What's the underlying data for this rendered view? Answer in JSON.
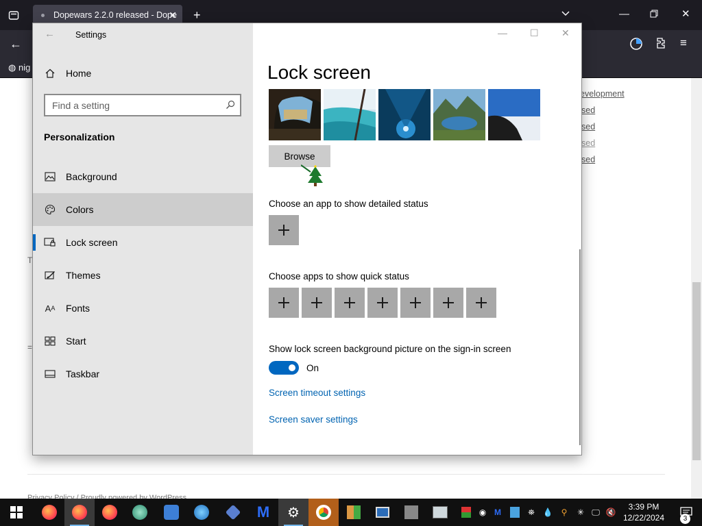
{
  "browser": {
    "tab_title": "Dopewars 2.2.0 released - Dope",
    "bookmark_label": "nig"
  },
  "background_page": {
    "links": [
      "evelopment",
      "sed",
      "sed",
      "sed",
      "sed"
    ],
    "fragments": [
      "T",
      "=",
      "Privacy Policy / Proudly powered by WordPress"
    ]
  },
  "settings": {
    "window_title": "Settings",
    "sidebar": {
      "home_label": "Home",
      "search_placeholder": "Find a setting",
      "section_heading": "Personalization",
      "items": [
        {
          "label": "Background",
          "icon": "image-icon"
        },
        {
          "label": "Colors",
          "icon": "palette-icon"
        },
        {
          "label": "Lock screen",
          "icon": "lock-screen-icon"
        },
        {
          "label": "Themes",
          "icon": "themes-icon"
        },
        {
          "label": "Fonts",
          "icon": "fonts-icon"
        },
        {
          "label": "Start",
          "icon": "start-icon"
        },
        {
          "label": "Taskbar",
          "icon": "taskbar-icon"
        }
      ],
      "active_item": "Lock screen",
      "hovered_item": "Colors"
    },
    "content": {
      "page_title": "Lock screen",
      "browse_label": "Browse",
      "detailed_status_label": "Choose an app to show detailed status",
      "quick_status_label": "Choose apps to show quick status",
      "quick_status_slots": 7,
      "signin_picture_label": "Show lock screen background picture on the sign-in screen",
      "toggle_state": "On",
      "screen_timeout_link": "Screen timeout settings",
      "screen_saver_link": "Screen saver settings"
    }
  },
  "taskbar": {
    "apps": [
      "firefox",
      "firefox",
      "firefox",
      "globe-app",
      "network-app",
      "ie-app",
      "network-app-2",
      "malwarebytes",
      "settings",
      "chrome-app",
      "image-app",
      "window-app",
      "archive-app",
      "display-app"
    ],
    "clock_time": "3:39 PM",
    "clock_date": "12/22/2024",
    "notification_count": "3"
  },
  "colors": {
    "accent": "#0067c0",
    "link": "#0063b1",
    "sidebar_bg": "#e6e6e6",
    "hover_bg": "#cdcdcd",
    "plus_tile_bg": "#a8a8a8"
  }
}
